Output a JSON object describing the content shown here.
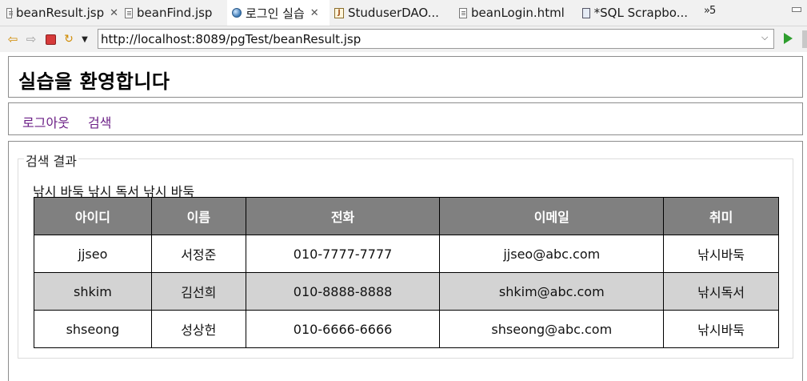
{
  "tabs": [
    {
      "label": "beanResult.jsp",
      "icon": "jsp-file-icon",
      "closable": true,
      "active": false
    },
    {
      "label": "beanFind.jsp",
      "icon": "jsp-file-icon",
      "closable": false,
      "active": false
    },
    {
      "label": "로그인 실습",
      "icon": "globe-icon",
      "closable": true,
      "active": true
    },
    {
      "label": "StuduserDAO...",
      "icon": "java-file-icon",
      "closable": false,
      "active": false
    },
    {
      "label": "beanLogin.html",
      "icon": "html-file-icon",
      "closable": false,
      "active": false
    },
    {
      "label": "*SQL Scrapbo...",
      "icon": "sql-scrapbook-icon",
      "closable": false,
      "active": false
    }
  ],
  "tab_overflow": "»5",
  "toolbar": {
    "back_icon": "back-arrow-icon",
    "forward_icon": "forward-arrow-icon",
    "stop_icon": "stop-icon",
    "refresh_icon": "refresh-icon",
    "url": "http://localhost:8089/pgTest/beanResult.jsp",
    "go_icon": "go-icon"
  },
  "page": {
    "title": "실습을 환영합니다",
    "menu": {
      "logout": "로그아웃",
      "search": "검색"
    },
    "legend": "검색 결과",
    "hobbies_line": "낚시 바둑 낚시 독서 낚시 바둑",
    "table": {
      "headers": [
        "아이디",
        "이름",
        "전화",
        "이메일",
        "취미"
      ],
      "rows": [
        [
          "jjseo",
          "서정준",
          "010-7777-7777",
          "jjseo@abc.com",
          "낚시바둑"
        ],
        [
          "shkim",
          "김선희",
          "010-8888-8888",
          "shkim@abc.com",
          "낚시독서"
        ],
        [
          "shseong",
          "성상헌",
          "010-6666-6666",
          "shseong@abc.com",
          "낚시바둑"
        ]
      ]
    }
  },
  "colors": {
    "link": "#6b1f86",
    "table_header_bg": "#808080",
    "alt_row_bg": "#d3d3d3",
    "go_button": "#2e9e2e"
  }
}
